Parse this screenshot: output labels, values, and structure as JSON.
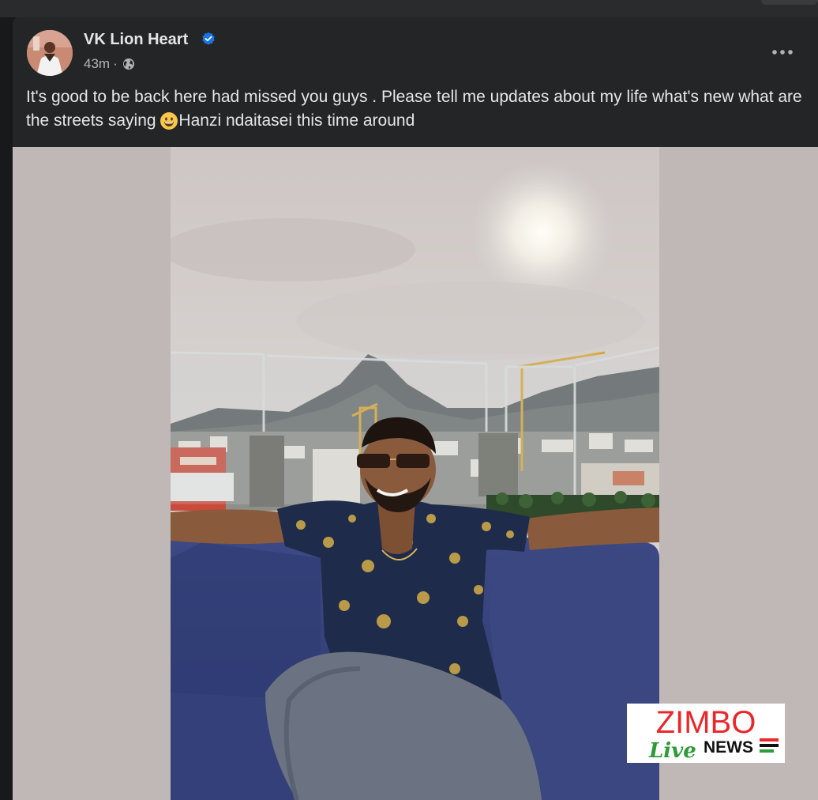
{
  "post": {
    "author": "VK Lion Heart",
    "time": "43m",
    "separator": "·",
    "text_before_emoji": "It's good to be back here had missed you guys . Please tell me updates about my life what's new what are the streets saying ",
    "text_after_emoji": "Hanzi ndaitasei this time around"
  },
  "watermark": {
    "brand": "ZIMBO",
    "sub": "Live",
    "news": "NEWS"
  },
  "icons": {
    "verified": "verified-badge-icon",
    "audience": "globe-icon",
    "more": "more-options-icon",
    "emoji": "grinning-face-emoji"
  },
  "colors": {
    "background": "#18191a",
    "card": "#242526",
    "text_primary": "#e4e6eb",
    "text_secondary": "#b0b3b8",
    "verified": "#1b74e4",
    "media_background": "#c0b8b7",
    "watermark_red": "#e8282b",
    "watermark_green": "#2e9a3a"
  }
}
